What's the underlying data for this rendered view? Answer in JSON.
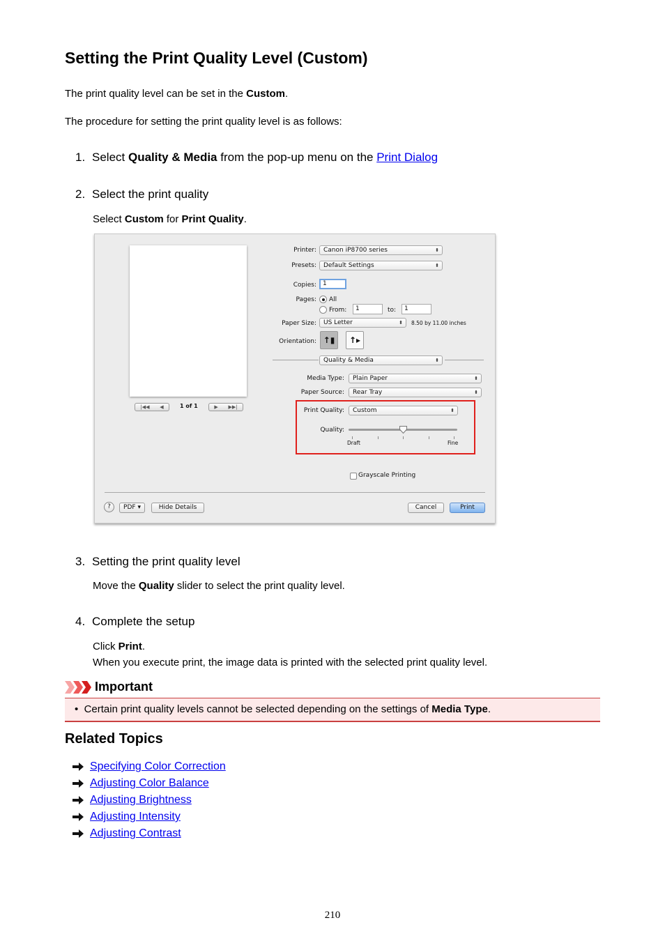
{
  "title": "Setting the Print Quality Level (Custom)",
  "intro": {
    "line1_prefix": "The print quality level can be set in the ",
    "line1_bold": "Custom",
    "line1_suffix": ".",
    "line2": "The procedure for setting the print quality level is as follows:"
  },
  "steps": [
    {
      "num": "1.",
      "prefix": "Select ",
      "bold": "Quality & Media",
      "middle": " from the pop-up menu on the ",
      "link": "Print Dialog"
    },
    {
      "num": "2.",
      "text": "Select the print quality",
      "sub_prefix": "Select ",
      "sub_bold1": "Custom",
      "sub_mid": " for ",
      "sub_bold2": "Print Quality",
      "sub_suffix": "."
    },
    {
      "num": "3.",
      "text": "Setting the print quality level",
      "sub_prefix": "Move the ",
      "sub_bold": "Quality",
      "sub_suffix": " slider to select the print quality level."
    },
    {
      "num": "4.",
      "text": "Complete the setup",
      "sub1_prefix": "Click ",
      "sub1_bold": "Print",
      "sub1_suffix": ".",
      "sub2": "When you execute print, the image data is printed with the selected print quality level."
    }
  ],
  "dialog": {
    "page_count": "1 of 1",
    "printer_label": "Printer:",
    "printer_value": "Canon iP8700 series",
    "presets_label": "Presets:",
    "presets_value": "Default Settings",
    "copies_label": "Copies:",
    "copies_value": "1",
    "pages_label": "Pages:",
    "pages_all": "All",
    "pages_from": "From:",
    "pages_from_value": "1",
    "pages_to": "to:",
    "pages_to_value": "1",
    "paper_size_label": "Paper Size:",
    "paper_size_value": "US Letter",
    "paper_size_dims": "8.50 by 11.00 inches",
    "orientation_label": "Orientation:",
    "panel_menu": "Quality & Media",
    "media_type_label": "Media Type:",
    "media_type_value": "Plain Paper",
    "paper_source_label": "Paper Source:",
    "paper_source_value": "Rear Tray",
    "print_quality_label": "Print Quality:",
    "print_quality_value": "Custom",
    "quality_label": "Quality:",
    "quality_min": "Draft",
    "quality_max": "Fine",
    "quality_level": 3,
    "quality_levels": 5,
    "grayscale_label": "Grayscale Printing",
    "grayscale_checked": false,
    "help": "?",
    "pdf": "PDF",
    "hide_details": "Hide Details",
    "cancel": "Cancel",
    "print": "Print",
    "highlight_color": "#e0201c"
  },
  "important": {
    "title": "Important",
    "item_prefix": "Certain print quality levels cannot be selected depending on the settings of ",
    "item_bold": "Media Type",
    "item_suffix": ".",
    "accent": "#c94040",
    "bg": "#fde9e9"
  },
  "related": {
    "title": "Related Topics",
    "links": [
      "Specifying Color Correction",
      "Adjusting Color Balance",
      "Adjusting Brightness",
      "Adjusting Intensity",
      "Adjusting Contrast"
    ]
  },
  "page_number": "210"
}
